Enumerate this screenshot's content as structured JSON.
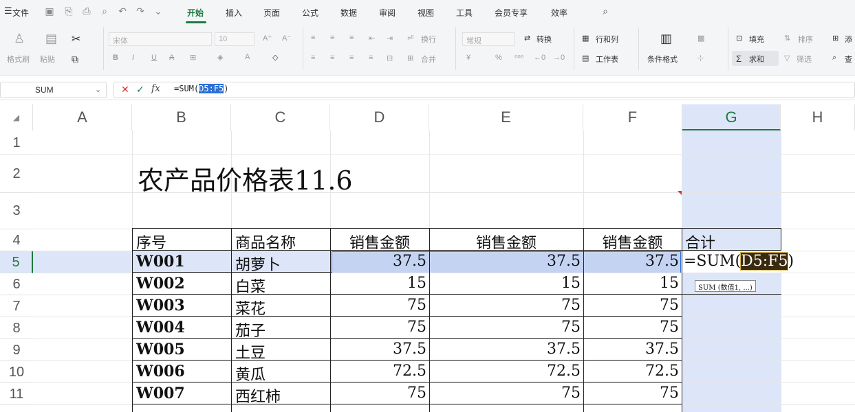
{
  "menubar": {
    "file": "文件",
    "tabs": [
      "开始",
      "插入",
      "页面",
      "公式",
      "数据",
      "审阅",
      "视图",
      "工具",
      "会员专享",
      "效率"
    ]
  },
  "ribbon": {
    "format_painter": "格式刷",
    "paste": "粘贴",
    "font_name": "宋体",
    "font_size": "10",
    "wrap": "换行",
    "merge": "合并",
    "number_format": "常规",
    "convert": "转换",
    "row_col": "行和列",
    "worksheet": "工作表",
    "cond_format": "条件格式",
    "fill": "填充",
    "sort": "排序",
    "sum": "求和",
    "filter": "筛选",
    "find": "查",
    "add": "添"
  },
  "formula_bar": {
    "name_box": "SUM",
    "formula_prefix": "=SUM(",
    "formula_ref": "D5:F5",
    "formula_suffix": ")"
  },
  "grid": {
    "columns": [
      "A",
      "B",
      "C",
      "D",
      "E",
      "F",
      "G",
      "H"
    ],
    "rows": [
      "1",
      "2",
      "3",
      "4",
      "5",
      "6",
      "7",
      "8",
      "9",
      "10",
      "11"
    ],
    "title": "农产品价格表11.6",
    "headers": [
      "序号",
      "商品名称",
      "销售金额",
      "销售金额",
      "销售金额",
      "合计"
    ],
    "data": [
      {
        "code": "W001",
        "name": "胡萝卜",
        "d": "37.5",
        "e": "37.5",
        "f": "37.5"
      },
      {
        "code": "W002",
        "name": "白菜",
        "d": "15",
        "e": "15",
        "f": "15"
      },
      {
        "code": "W003",
        "name": "菜花",
        "d": "75",
        "e": "75",
        "f": "75"
      },
      {
        "code": "W004",
        "name": "茄子",
        "d": "75",
        "e": "75",
        "f": "75"
      },
      {
        "code": "W005",
        "name": "土豆",
        "d": "37.5",
        "e": "37.5",
        "f": "37.5"
      },
      {
        "code": "W006",
        "name": "黄瓜",
        "d": "72.5",
        "e": "72.5",
        "f": "72.5"
      },
      {
        "code": "W007",
        "name": "西红柿",
        "d": "75",
        "e": "75",
        "f": "75"
      }
    ],
    "editing_cell": {
      "prefix": "=SUM(",
      "ref": "D5:F5",
      "suffix": ")"
    },
    "tooltip": "SUM (数值1, ...)"
  },
  "colors": {
    "accent": "#1b7a3e",
    "selection": "#dde6f8",
    "range_fill": "#c5d3f3",
    "ref_highlight": "#3a2a10"
  }
}
